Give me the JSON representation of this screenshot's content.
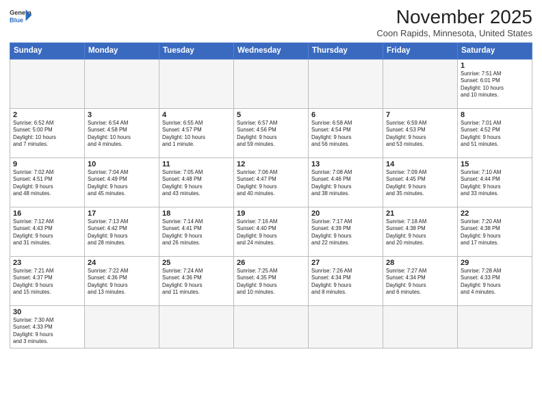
{
  "header": {
    "logo_general": "General",
    "logo_blue": "Blue",
    "month_title": "November 2025",
    "location": "Coon Rapids, Minnesota, United States"
  },
  "days_of_week": [
    "Sunday",
    "Monday",
    "Tuesday",
    "Wednesday",
    "Thursday",
    "Friday",
    "Saturday"
  ],
  "weeks": [
    [
      {
        "day": "",
        "info": ""
      },
      {
        "day": "",
        "info": ""
      },
      {
        "day": "",
        "info": ""
      },
      {
        "day": "",
        "info": ""
      },
      {
        "day": "",
        "info": ""
      },
      {
        "day": "",
        "info": ""
      },
      {
        "day": "1",
        "info": "Sunrise: 7:51 AM\nSunset: 6:01 PM\nDaylight: 10 hours\nand 10 minutes."
      }
    ],
    [
      {
        "day": "2",
        "info": "Sunrise: 6:52 AM\nSunset: 5:00 PM\nDaylight: 10 hours\nand 7 minutes."
      },
      {
        "day": "3",
        "info": "Sunrise: 6:54 AM\nSunset: 4:58 PM\nDaylight: 10 hours\nand 4 minutes."
      },
      {
        "day": "4",
        "info": "Sunrise: 6:55 AM\nSunset: 4:57 PM\nDaylight: 10 hours\nand 1 minute."
      },
      {
        "day": "5",
        "info": "Sunrise: 6:57 AM\nSunset: 4:56 PM\nDaylight: 9 hours\nand 59 minutes."
      },
      {
        "day": "6",
        "info": "Sunrise: 6:58 AM\nSunset: 4:54 PM\nDaylight: 9 hours\nand 56 minutes."
      },
      {
        "day": "7",
        "info": "Sunrise: 6:59 AM\nSunset: 4:53 PM\nDaylight: 9 hours\nand 53 minutes."
      },
      {
        "day": "8",
        "info": "Sunrise: 7:01 AM\nSunset: 4:52 PM\nDaylight: 9 hours\nand 51 minutes."
      }
    ],
    [
      {
        "day": "9",
        "info": "Sunrise: 7:02 AM\nSunset: 4:51 PM\nDaylight: 9 hours\nand 48 minutes."
      },
      {
        "day": "10",
        "info": "Sunrise: 7:04 AM\nSunset: 4:49 PM\nDaylight: 9 hours\nand 45 minutes."
      },
      {
        "day": "11",
        "info": "Sunrise: 7:05 AM\nSunset: 4:48 PM\nDaylight: 9 hours\nand 43 minutes."
      },
      {
        "day": "12",
        "info": "Sunrise: 7:06 AM\nSunset: 4:47 PM\nDaylight: 9 hours\nand 40 minutes."
      },
      {
        "day": "13",
        "info": "Sunrise: 7:08 AM\nSunset: 4:46 PM\nDaylight: 9 hours\nand 38 minutes."
      },
      {
        "day": "14",
        "info": "Sunrise: 7:09 AM\nSunset: 4:45 PM\nDaylight: 9 hours\nand 35 minutes."
      },
      {
        "day": "15",
        "info": "Sunrise: 7:10 AM\nSunset: 4:44 PM\nDaylight: 9 hours\nand 33 minutes."
      }
    ],
    [
      {
        "day": "16",
        "info": "Sunrise: 7:12 AM\nSunset: 4:43 PM\nDaylight: 9 hours\nand 31 minutes."
      },
      {
        "day": "17",
        "info": "Sunrise: 7:13 AM\nSunset: 4:42 PM\nDaylight: 9 hours\nand 28 minutes."
      },
      {
        "day": "18",
        "info": "Sunrise: 7:14 AM\nSunset: 4:41 PM\nDaylight: 9 hours\nand 26 minutes."
      },
      {
        "day": "19",
        "info": "Sunrise: 7:16 AM\nSunset: 4:40 PM\nDaylight: 9 hours\nand 24 minutes."
      },
      {
        "day": "20",
        "info": "Sunrise: 7:17 AM\nSunset: 4:39 PM\nDaylight: 9 hours\nand 22 minutes."
      },
      {
        "day": "21",
        "info": "Sunrise: 7:18 AM\nSunset: 4:38 PM\nDaylight: 9 hours\nand 20 minutes."
      },
      {
        "day": "22",
        "info": "Sunrise: 7:20 AM\nSunset: 4:38 PM\nDaylight: 9 hours\nand 17 minutes."
      }
    ],
    [
      {
        "day": "23",
        "info": "Sunrise: 7:21 AM\nSunset: 4:37 PM\nDaylight: 9 hours\nand 15 minutes."
      },
      {
        "day": "24",
        "info": "Sunrise: 7:22 AM\nSunset: 4:36 PM\nDaylight: 9 hours\nand 13 minutes."
      },
      {
        "day": "25",
        "info": "Sunrise: 7:24 AM\nSunset: 4:36 PM\nDaylight: 9 hours\nand 11 minutes."
      },
      {
        "day": "26",
        "info": "Sunrise: 7:25 AM\nSunset: 4:35 PM\nDaylight: 9 hours\nand 10 minutes."
      },
      {
        "day": "27",
        "info": "Sunrise: 7:26 AM\nSunset: 4:34 PM\nDaylight: 9 hours\nand 8 minutes."
      },
      {
        "day": "28",
        "info": "Sunrise: 7:27 AM\nSunset: 4:34 PM\nDaylight: 9 hours\nand 6 minutes."
      },
      {
        "day": "29",
        "info": "Sunrise: 7:28 AM\nSunset: 4:33 PM\nDaylight: 9 hours\nand 4 minutes."
      }
    ],
    [
      {
        "day": "30",
        "info": "Sunrise: 7:30 AM\nSunset: 4:33 PM\nDaylight: 9 hours\nand 3 minutes."
      },
      {
        "day": "",
        "info": ""
      },
      {
        "day": "",
        "info": ""
      },
      {
        "day": "",
        "info": ""
      },
      {
        "day": "",
        "info": ""
      },
      {
        "day": "",
        "info": ""
      },
      {
        "day": "",
        "info": ""
      }
    ]
  ]
}
